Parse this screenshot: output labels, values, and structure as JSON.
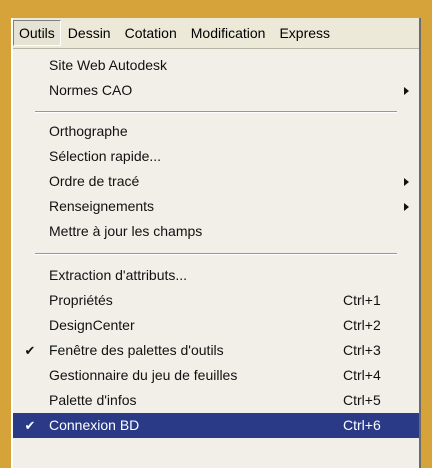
{
  "menubar": {
    "items": [
      "Outils",
      "Dessin",
      "Cotation",
      "Modification",
      "Express"
    ]
  },
  "menu": {
    "group1": [
      {
        "label": "Site Web Autodesk",
        "shortcut": "",
        "submenu": false,
        "checked": false
      },
      {
        "label": "Normes CAO",
        "shortcut": "",
        "submenu": true,
        "checked": false
      }
    ],
    "group2": [
      {
        "label": "Orthographe",
        "shortcut": "",
        "submenu": false,
        "checked": false
      },
      {
        "label": "Sélection rapide...",
        "shortcut": "",
        "submenu": false,
        "checked": false
      },
      {
        "label": "Ordre de tracé",
        "shortcut": "",
        "submenu": true,
        "checked": false
      },
      {
        "label": "Renseignements",
        "shortcut": "",
        "submenu": true,
        "checked": false
      },
      {
        "label": "Mettre à jour les champs",
        "shortcut": "",
        "submenu": false,
        "checked": false
      }
    ],
    "group3": [
      {
        "label": "Extraction d'attributs...",
        "shortcut": "",
        "submenu": false,
        "checked": false
      },
      {
        "label": "Propriétés",
        "shortcut": "Ctrl+1",
        "submenu": false,
        "checked": false
      },
      {
        "label": "DesignCenter",
        "shortcut": "Ctrl+2",
        "submenu": false,
        "checked": false
      },
      {
        "label": "Fenêtre des palettes d'outils",
        "shortcut": "Ctrl+3",
        "submenu": false,
        "checked": true
      },
      {
        "label": "Gestionnaire du jeu de feuilles",
        "shortcut": "Ctrl+4",
        "submenu": false,
        "checked": false
      },
      {
        "label": "Palette d'infos",
        "shortcut": "Ctrl+5",
        "submenu": false,
        "checked": false
      },
      {
        "label": "Connexion BD",
        "shortcut": "Ctrl+6",
        "submenu": false,
        "checked": true,
        "highlighted": true
      }
    ]
  },
  "icons": {
    "check": "checkmark-icon",
    "submenu": "submenu-arrow-icon"
  },
  "colors": {
    "highlight": "#2a3a86",
    "menu_bg": "#f1efe8",
    "border_outer": "#d6a23a"
  }
}
